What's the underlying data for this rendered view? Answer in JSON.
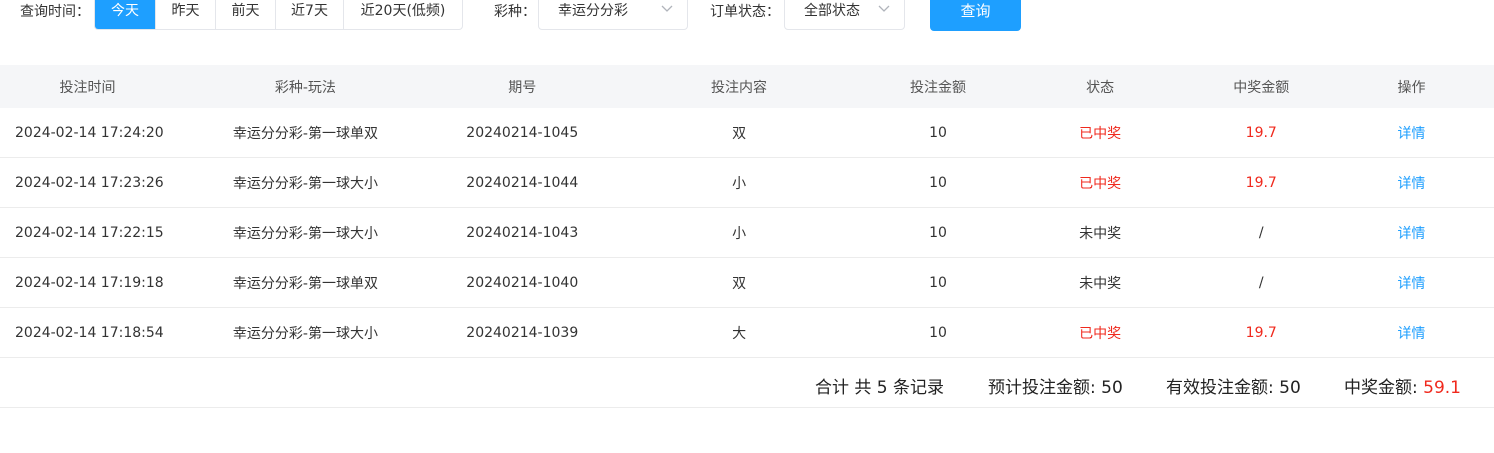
{
  "filters": {
    "time_label": "查询时间：",
    "time_options": [
      "今天",
      "昨天",
      "前天",
      "近7天",
      "近20天(低频)"
    ],
    "time_selected": "今天",
    "lottery_label": "彩种：",
    "lottery_value": "幸运分分彩",
    "status_label": "订单状态：",
    "status_value": "全部状态",
    "query_button": "查询"
  },
  "table": {
    "headers": [
      "投注时间",
      "彩种-玩法",
      "期号",
      "投注内容",
      "投注金额",
      "状态",
      "中奖金额",
      "操作"
    ],
    "rows": [
      {
        "time": "2024-02-14 17:24:20",
        "game": "幸运分分彩-第一球单双",
        "issue": "20240214-1045",
        "content": "双",
        "amount": "10",
        "status": "已中奖",
        "win": "19.7",
        "action": "详情",
        "won": true
      },
      {
        "time": "2024-02-14 17:23:26",
        "game": "幸运分分彩-第一球大小",
        "issue": "20240214-1044",
        "content": "小",
        "amount": "10",
        "status": "已中奖",
        "win": "19.7",
        "action": "详情",
        "won": true
      },
      {
        "time": "2024-02-14 17:22:15",
        "game": "幸运分分彩-第一球大小",
        "issue": "20240214-1043",
        "content": "小",
        "amount": "10",
        "status": "未中奖",
        "win": "/",
        "action": "详情",
        "won": false
      },
      {
        "time": "2024-02-14 17:19:18",
        "game": "幸运分分彩-第一球单双",
        "issue": "20240214-1040",
        "content": "双",
        "amount": "10",
        "status": "未中奖",
        "win": "/",
        "action": "详情",
        "won": false
      },
      {
        "time": "2024-02-14 17:18:54",
        "game": "幸运分分彩-第一球大小",
        "issue": "20240214-1039",
        "content": "大",
        "amount": "10",
        "status": "已中奖",
        "win": "19.7",
        "action": "详情",
        "won": true
      }
    ]
  },
  "summary": {
    "count_text": "合计 共 5 条记录",
    "expected_label": "预计投注金额: ",
    "expected_value": "50",
    "valid_label": "有效投注金额: ",
    "valid_value": "50",
    "win_label": "中奖金额: ",
    "win_value": "59.1"
  },
  "colors": {
    "accent": "#1e9fff",
    "win_red": "#f0291d",
    "header_bg": "#f5f6f8"
  }
}
